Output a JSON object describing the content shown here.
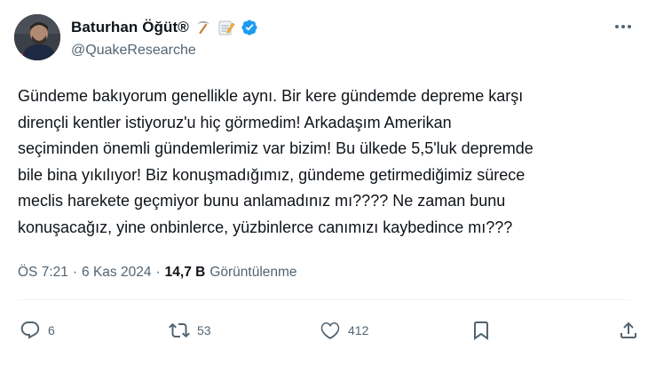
{
  "author": {
    "name": "Baturhan Öğüt®",
    "handle": "@QuakeResearche",
    "verified": true,
    "emojis": [
      "pick-icon",
      "memo-icon"
    ]
  },
  "tweet": {
    "text": "Gündeme bakıyorum genellikle aynı. Bir kere gündemde depreme karşı\ndirençli kentler istiyoruz'u hiç görmedim! Arkadaşım Amerikan\nseçiminden önemli gündemlerimiz var bizim! Bu ülkede 5,5'luk depremde\nbile bina yıkılıyor! Biz konuşmadığımız, gündeme getirmediğimiz sürece\nmeclis harekete geçmiyor bunu anlamadınız mı???? Ne zaman bunu\nkonuşacağız, yine onbinlerce, yüzbinlerce canımızı kaybedince mı???",
    "time": "ÖS 7:21",
    "separator": "·",
    "date": "6 Kas 2024",
    "views_count": "14,7 B",
    "views_label": "Görüntülenme"
  },
  "actions": {
    "replies": "6",
    "retweets": "53",
    "likes": "412"
  },
  "colors": {
    "text": "#0f1419",
    "secondary": "#536471",
    "verified": "#1d9bf0",
    "divider": "#eff3f4"
  }
}
